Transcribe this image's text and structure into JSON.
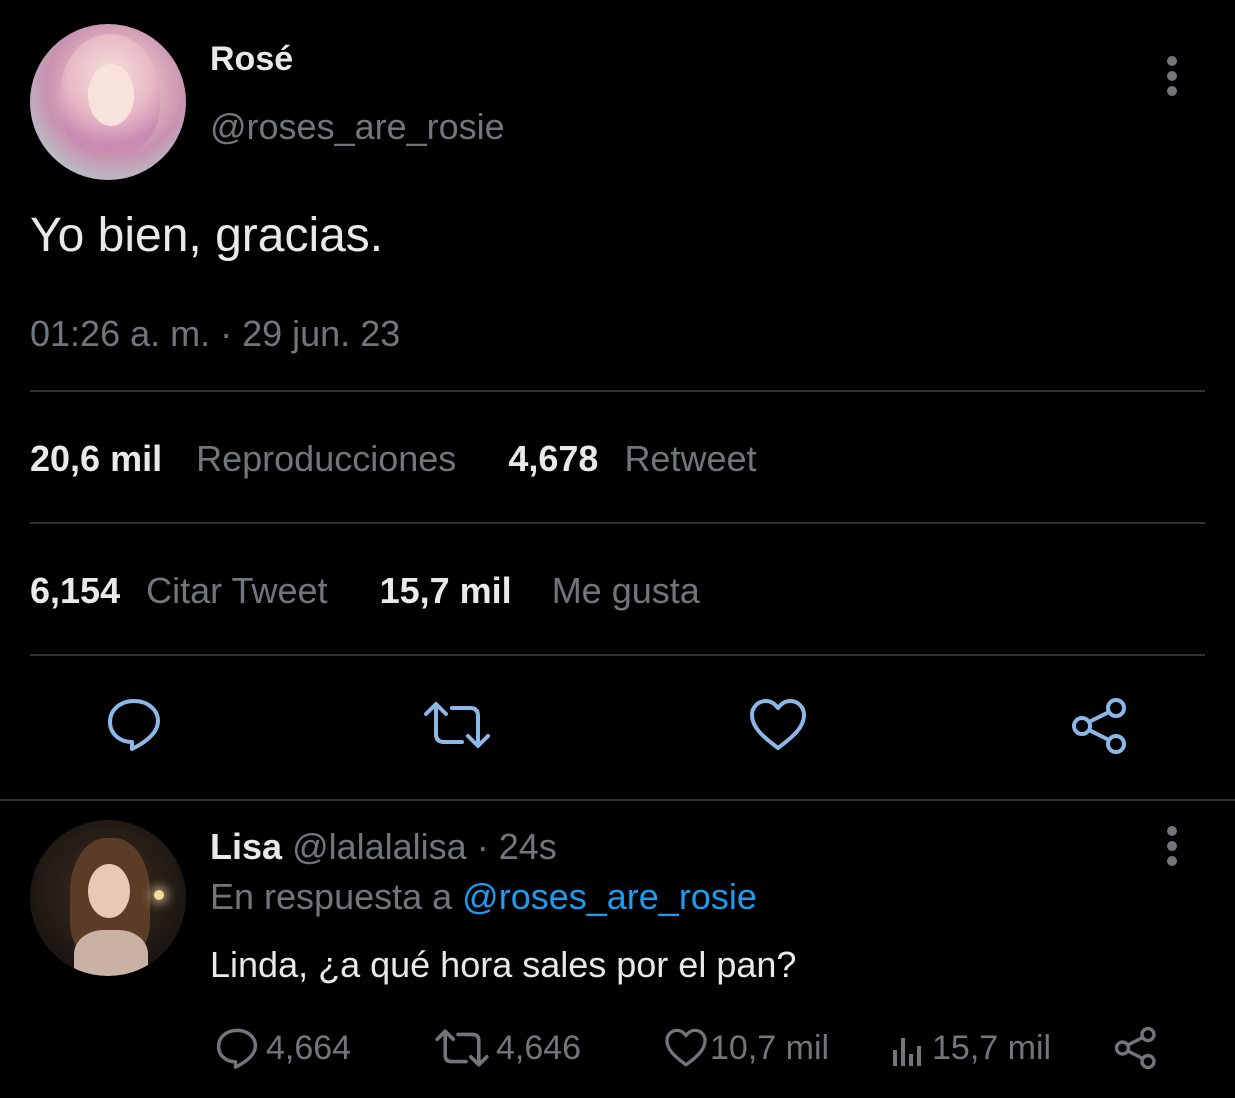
{
  "main_tweet": {
    "author_name": "Rosé",
    "author_handle": "@roses_are_rosie",
    "text": "Yo bien, gracias.",
    "timestamp": "01:26 a. m. · 29 jun. 23",
    "stats": {
      "views_count": "20,6 mil",
      "views_label": "Reproducciones",
      "retweets_count": "4,678",
      "retweets_label": "Retweet",
      "quotes_count": "6,154",
      "quotes_label": "Citar Tweet",
      "likes_count": "15,7 mil",
      "likes_label": "Me gusta"
    },
    "actions": [
      "reply-icon",
      "retweet-icon",
      "like-icon",
      "share-icon"
    ]
  },
  "reply": {
    "author_name": "Lisa",
    "author_handle": "@lalalalisa",
    "time": "· 24s",
    "reply_to_label": "En respuesta a",
    "reply_to_handle": "@roses_are_rosie",
    "text": "Linda, ¿a qué hora sales por el pan?",
    "counts": {
      "replies": "4,664",
      "retweets": "4,646",
      "likes": "10,7 mil",
      "views": "15,7 mil"
    }
  },
  "colors": {
    "background": "#000000",
    "primary_text": "#e7e9ea",
    "secondary_text": "#71767b",
    "divider": "#2f3336",
    "link": "#1d9bf0",
    "icon": "#8bb8e8"
  }
}
